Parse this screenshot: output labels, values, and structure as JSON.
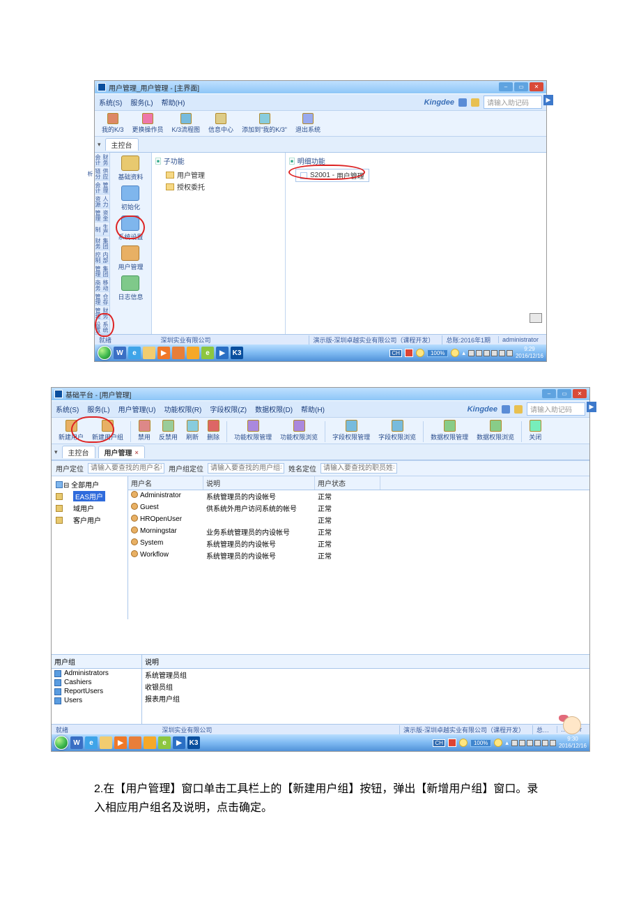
{
  "shot1": {
    "title": "用户管理_用户管理 - [主界面]",
    "menu": [
      "系统(S)",
      "服务(L)",
      "帮助(H)"
    ],
    "brand": "Kingdee",
    "help_placeholder": "请输入助记码",
    "toolbar": [
      "我的K/3",
      "更换操作员",
      "K/3流程图",
      "信息中心",
      "添加到\"我的K/3\"",
      "退出系统"
    ],
    "tab": "主控台",
    "vertical_tabs": [
      "财务会计",
      "供应链分析",
      "管理会计",
      "人力资源",
      "资金管理",
      "生产制",
      "集团财务",
      "内部控制",
      "集团管理",
      "移动商务",
      "仓存管理",
      "财务管理",
      "系统设置"
    ],
    "side_items": [
      "基础资料",
      "初始化",
      "系统设置",
      "用户管理",
      "日志信息"
    ],
    "sub_header": "子功能",
    "sub_items": [
      "用户管理",
      "授权委托"
    ],
    "detail_header": "明细功能",
    "detail_item_code": "S2001",
    "detail_item_name": "用户管理",
    "status_left": "就绪",
    "status_center": "深圳实业有限公司",
    "status_r1": "演示版-深圳卓越实业有限公司（课程开发）",
    "status_r2": "总账:2016年1期",
    "status_r3": "administrator",
    "task_zoom": "100%",
    "task_lang": "CH",
    "task_ime": "S",
    "clock_time": "9:29",
    "clock_date": "2016/12/16"
  },
  "shot2": {
    "title": "基础平台 - [用户管理]",
    "menu": [
      "系统(S)",
      "服务(L)",
      "用户管理(U)",
      "功能权限(R)",
      "字段权限(Z)",
      "数据权限(D)",
      "帮助(H)"
    ],
    "brand": "Kingdee",
    "help_placeholder": "请输入助记码",
    "toolbar": [
      "新建用户",
      "新建用户组",
      "禁用",
      "反禁用",
      "刷新",
      "删除",
      "功能权限管理",
      "功能权限浏览",
      "字段权限管理",
      "字段权限浏览",
      "数据权限管理",
      "数据权限浏览",
      "关闭"
    ],
    "tab1": "主控台",
    "tab2": "用户管理",
    "filter_labels": [
      "用户定位",
      "用户组定位",
      "姓名定位"
    ],
    "filter_ph1": "请输入要查找的用户名称",
    "filter_ph2": "请输入要查找的用户组名称",
    "filter_ph3": "请输入要查找的职员姓名",
    "tree_root": "全部用户",
    "tree_items": [
      "EAS用户",
      "域用户",
      "客户用户"
    ],
    "grid_headers": [
      "用户名",
      "说明",
      "用户状态"
    ],
    "grid_rows": [
      {
        "name": "Administrator",
        "desc": "系统管理员的内设帐号",
        "status": "正常"
      },
      {
        "name": "Guest",
        "desc": "供系统外用户访问系统的帐号",
        "status": "正常"
      },
      {
        "name": "HROpenUser",
        "desc": "",
        "status": "正常"
      },
      {
        "name": "Morningstar",
        "desc": "业务系统管理员的内设帐号",
        "status": "正常"
      },
      {
        "name": "System",
        "desc": "系统管理员的内设帐号",
        "status": "正常"
      },
      {
        "name": "Workflow",
        "desc": "系统管理员的内设帐号",
        "status": "正常"
      }
    ],
    "group_headers": [
      "用户组",
      "说明"
    ],
    "group_rows": [
      {
        "name": "Administrators",
        "desc": "系统管理员组"
      },
      {
        "name": "Cashiers",
        "desc": "收银员组"
      },
      {
        "name": "ReportUsers",
        "desc": "报表用户组"
      },
      {
        "name": "Users",
        "desc": ""
      }
    ],
    "status_left": "就绪",
    "status_center": "深圳实业有限公司",
    "status_r1": "演示版-深圳卓越实业有限公司（课程开发）",
    "status_r2": "总…",
    "status_r3": "…trator",
    "task_zoom": "100%",
    "task_lang": "CH",
    "task_ime": "S",
    "clock_time": "9:30",
    "clock_date": "2016/12/16"
  },
  "caption": "2.在【用户管理】窗口单击工具栏上的【新建用户组】按钮，弹出【新增用户组】窗口。录入相应用户组名及说明，点击确定。"
}
